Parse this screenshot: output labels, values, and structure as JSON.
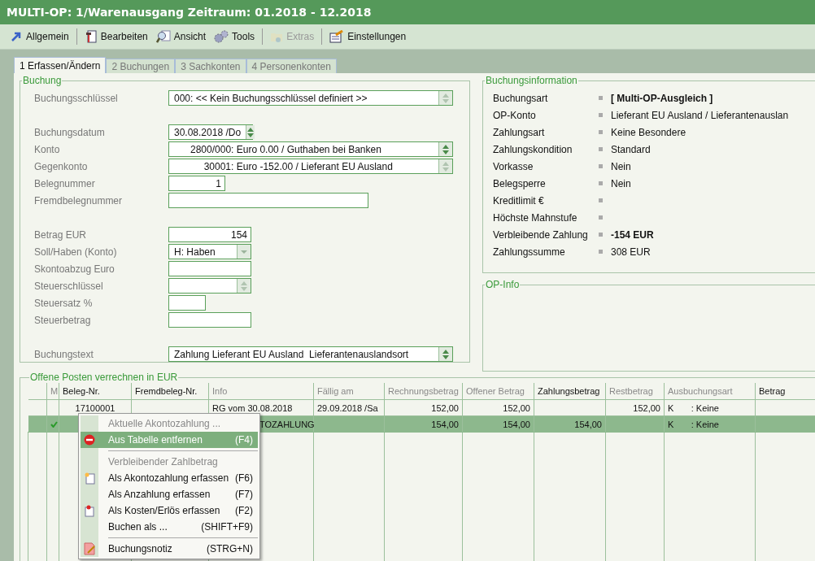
{
  "window": {
    "title": "MULTI-OP: 1/Warenausgang Zeitraum: 01.2018 - 12.2018"
  },
  "toolbar": [
    {
      "label": "Allgemein",
      "disabled": false
    },
    {
      "label": "Bearbeiten",
      "disabled": false
    },
    {
      "label": "Ansicht",
      "disabled": false
    },
    {
      "label": "Tools",
      "disabled": false
    },
    {
      "label": "Extras",
      "disabled": true
    },
    {
      "label": "Einstellungen",
      "disabled": false
    }
  ],
  "tabs": [
    {
      "label": "1 Erfassen/Ändern",
      "selected": true
    },
    {
      "label": "2 Buchungen",
      "selected": false
    },
    {
      "label": "3 Sachkonten",
      "selected": false
    },
    {
      "label": "4 Personenkonten",
      "selected": false
    }
  ],
  "buchung": {
    "title": "Buchung",
    "field_groups": [
      [
        {
          "label": "Buchungsschlüssel",
          "kind": "combo",
          "value": "000: << Kein Buchungsschlüssel definiert >>",
          "spinner_enabled": false
        }
      ],
      [
        {
          "label": "Buchungsdatum",
          "kind": "combo",
          "value": "30.08.2018 /Do",
          "spinner_enabled": true
        },
        {
          "label": "Konto",
          "kind": "combo",
          "value": "      2800/000: Euro 0.00 / Guthaben bei Banken",
          "spinner_enabled": true
        },
        {
          "label": "Gegenkonto",
          "kind": "combo",
          "value": "           30001: Euro -152.00 / Lieferant EU Ausland",
          "spinner_enabled": false
        },
        {
          "label": "Belegnummer",
          "kind": "number",
          "value": "1"
        },
        {
          "label": "Fremdbelegnummer",
          "kind": "text"
        }
      ],
      [
        {
          "label": "Betrag EUR",
          "kind": "number",
          "value": "154"
        },
        {
          "label": "Soll/Haben (Konto)",
          "kind": "dropdown",
          "value": "H: Haben"
        },
        {
          "label": "Skontoabzug Euro",
          "kind": "text"
        },
        {
          "label": "Steuerschlüssel",
          "kind": "combo",
          "spinner_enabled": false
        },
        {
          "label": "Steuersatz %",
          "kind": "text"
        },
        {
          "label": "Steuerbetrag",
          "kind": "text"
        }
      ],
      [
        {
          "label": "Buchungstext",
          "kind": "combo",
          "value": "Zahlung Lieferant EU Ausland  Lieferantenauslandsort",
          "spinner_enabled": true
        }
      ]
    ]
  },
  "buchungsinformation": {
    "title": "Buchungsinformation",
    "rows": [
      {
        "label": "Buchungsart",
        "value": "[ Multi-OP-Ausgleich ]",
        "emphasis": true
      },
      {
        "label": "OP-Konto",
        "value": "Lieferant EU Ausland / Lieferantenauslan",
        "emphasis": false
      },
      {
        "label": "Zahlungsart",
        "value": "Keine Besondere",
        "emphasis": false
      },
      {
        "label": "Zahlungskondition",
        "value": "Standard",
        "emphasis": false
      },
      {
        "label": "Vorkasse",
        "value": "Nein",
        "emphasis": false
      },
      {
        "label": "Belegsperre",
        "value": "Nein",
        "emphasis": false
      },
      {
        "label": "Kreditlimit €"
      },
      {
        "label": "Höchste Mahnstufe"
      },
      {
        "label": "Verbleibende Zahlung",
        "value": "-154 EUR",
        "emphasis": true
      },
      {
        "label": "Zahlungssumme",
        "value": "308 EUR",
        "emphasis": false
      }
    ]
  },
  "op_info": {
    "title": "OP-Info"
  },
  "offene_posten": {
    "title": "Offene Posten verrechnen in EUR",
    "columns": [
      {
        "label": "M",
        "disabled": true
      },
      {
        "label": "Beleg-Nr.",
        "disabled": false
      },
      {
        "label": "Fremdbeleg-Nr.",
        "disabled": false
      },
      {
        "label": "Info",
        "disabled": true
      },
      {
        "label": "Fällig am",
        "disabled": true
      },
      {
        "label": "Rechnungsbetrag",
        "disabled": true
      },
      {
        "label": "Offener Betrag",
        "disabled": true
      },
      {
        "label": "Zahlungsbetrag",
        "disabled": false
      },
      {
        "label": "Restbetrag",
        "disabled": true
      },
      {
        "label": "Ausbuchungsart",
        "disabled": true
      },
      {
        "label": "Betrag",
        "disabled": false
      }
    ],
    "rows": [
      {
        "selected": false,
        "marked": false,
        "cells": [
          "",
          "17100001",
          "",
          "RG vom 30.08.2018",
          "29.09.2018 /Sa",
          "152,00",
          "152,00",
          "",
          "152,00",
          "K       : Keine",
          ""
        ]
      },
      {
        "selected": true,
        "marked": true,
        "cells": [
          "",
          "",
          "",
          "TOZAHLUNG",
          "",
          "154,00",
          "154,00",
          "154,00",
          "",
          "K       : Keine",
          ""
        ]
      }
    ]
  },
  "context_menu": [
    {
      "kind": "header",
      "label": "Aktuelle Akontozahlung ..."
    },
    {
      "kind": "item",
      "label": "Aus Tabelle entfernen",
      "shortcut": "(F4)",
      "selected": true
    },
    {
      "kind": "separator"
    },
    {
      "kind": "header",
      "label": "Verbleibender Zahlbetrag"
    },
    {
      "kind": "item",
      "label": "Als Akontozahlung erfassen",
      "shortcut": "(F6)",
      "selected": false
    },
    {
      "kind": "item",
      "label": "Als Anzahlung erfassen",
      "shortcut": "(F7)",
      "selected": false
    },
    {
      "kind": "item",
      "label": "Als Kosten/Erlös erfassen",
      "shortcut": "(F2)",
      "selected": false
    },
    {
      "kind": "item",
      "label": "Buchen als ...",
      "shortcut": "(SHIFT+F9)",
      "selected": false
    },
    {
      "kind": "separator"
    },
    {
      "kind": "item",
      "label": "Buchungsnotiz",
      "shortcut": "(STRG+N)",
      "selected": false
    }
  ]
}
